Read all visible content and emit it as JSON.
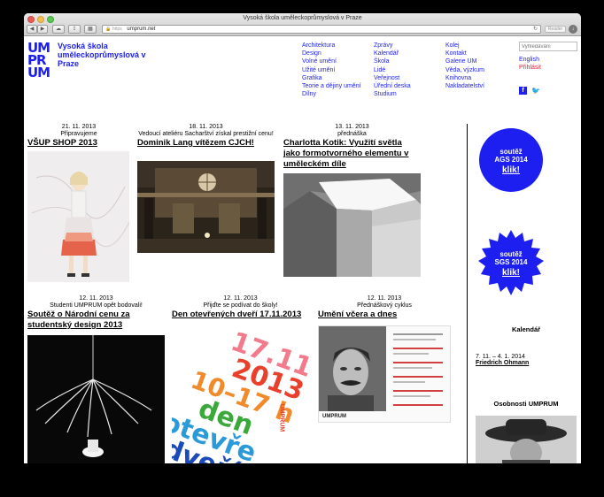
{
  "browser": {
    "window_title": "Vysoká škola uměleckoprůmyslová v Praze",
    "url_scheme": "https",
    "url": "umprum.net",
    "reader_label": "Reader"
  },
  "site": {
    "logo": [
      "UM",
      "PR",
      "UM"
    ],
    "name": "Vysoká škola uměleckoprůmyslová v Praze",
    "brand_color": "#1c1ff0",
    "nav_col1": [
      "Architektura",
      "Design",
      "Volné umění",
      "Užité umění",
      "Grafika",
      "Teorie a dějiny umění",
      "Dílny"
    ],
    "nav_col2": [
      "Zprávy",
      "Kalendář",
      "Škola",
      "Lidé",
      "Veřejnost",
      "Úřední deska",
      "Studium"
    ],
    "nav_col3": [
      "Kolej",
      "Kontakt",
      "Galerie UM",
      "Věda, výzkum",
      "Knihovna",
      "Nakladatelství"
    ],
    "search_placeholder": "Vyhledávání",
    "lang_label": "English",
    "login_label": "Přihlásit"
  },
  "posts": [
    {
      "date": "21. 11. 2013",
      "kicker": "Připravujeme",
      "title": "VŠUP SHOP 2013"
    },
    {
      "date": "18. 11. 2013",
      "kicker": "Vedoucí ateliéru Sacharštví získal prestižní cenu!",
      "title": "Dominik Lang vítězem CJCH!"
    },
    {
      "date": "13. 11. 2013",
      "kicker": "přednáška",
      "title": "Charlotta Kotik: Využití světla jako formotvorného elementu v uměleckém díle"
    },
    {
      "date": "12. 11. 2013",
      "kicker": "Studenti UMPRUM opět bodovali!",
      "title": "Soutěž o Národní cenu za studentský design 2013"
    },
    {
      "date": "12. 11. 2013",
      "kicker": "Přijďte se podívat do školy!",
      "title": "Den otevřených dveří 17.11.2013"
    },
    {
      "date": "12. 11. 2013",
      "kicker": "Přednáškový cyklus",
      "title": "Umění včera a dnes"
    }
  ],
  "poster": {
    "lines": [
      "17.11.",
      "2013",
      "10–17 h",
      "den",
      "otevře",
      "dveří"
    ],
    "tag": "UMPRUM"
  },
  "umprum_mark": "UMPRUM",
  "sidebar": {
    "badge1": {
      "line1": "soutěž",
      "line2": "AGS 2014",
      "klik": "klik!"
    },
    "badge2": {
      "line1": "soutěž",
      "line2": "SGS 2014",
      "klik": "klik!"
    },
    "calendar_heading": "Kalendář",
    "calendar_date": "7. 11. – 4. 1. 2014",
    "calendar_event": "Friedrich Ohmann",
    "people_heading": "Osobnosti UMPRUM"
  }
}
